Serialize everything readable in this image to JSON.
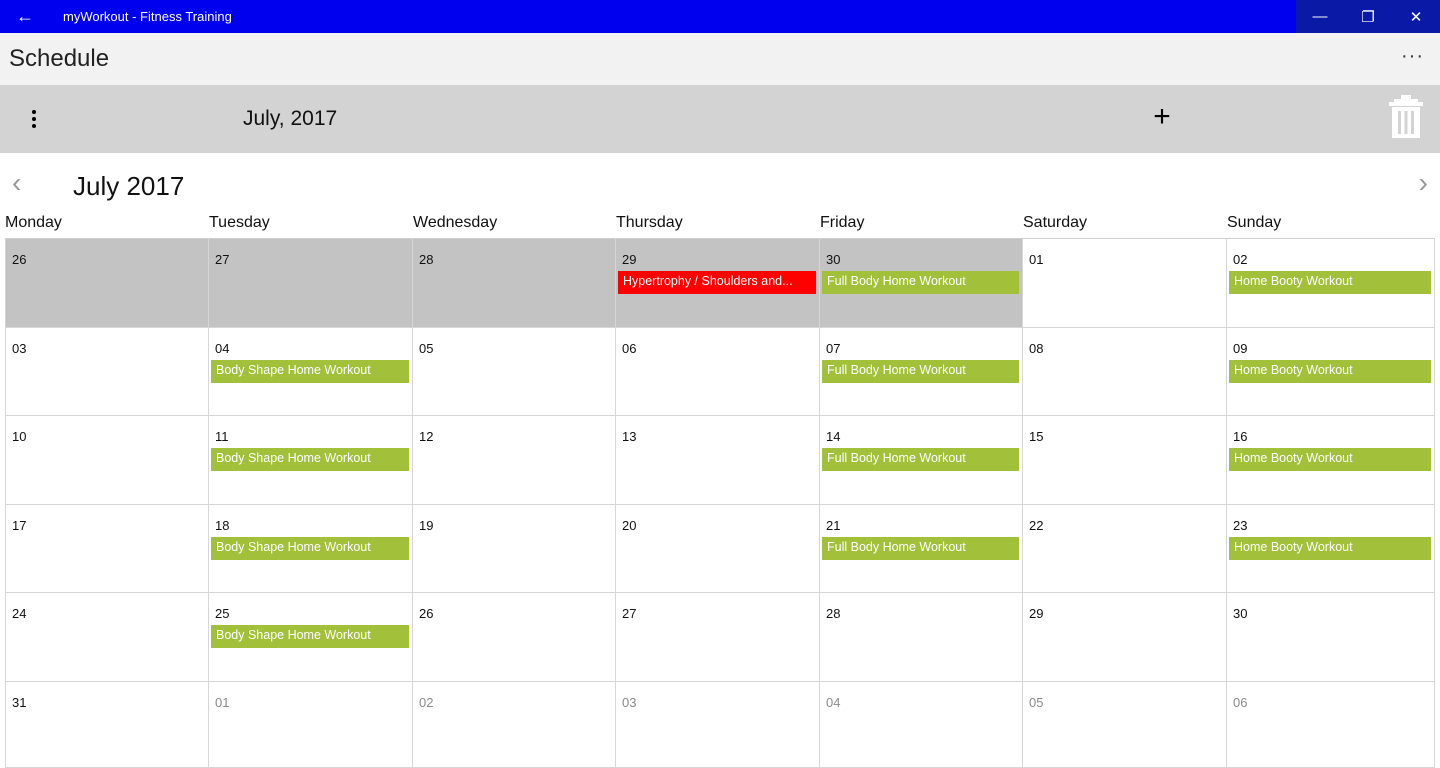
{
  "window": {
    "title": "myWorkout - Fitness Training",
    "back_icon": "←",
    "minimize_icon": "—",
    "restore_icon": "❐",
    "close_icon": "✕"
  },
  "header": {
    "title": "Schedule",
    "more_icon": "···"
  },
  "toolbar": {
    "month_label": "July, 2017",
    "add_icon": "+"
  },
  "calendar": {
    "title": "July 2017",
    "prev_icon": "‹",
    "next_icon": "›",
    "weekdays": [
      "Monday",
      "Tuesday",
      "Wednesday",
      "Thursday",
      "Friday",
      "Saturday",
      "Sunday"
    ],
    "rows": [
      [
        {
          "day": "26",
          "prev_month": true,
          "events": []
        },
        {
          "day": "27",
          "prev_month": true,
          "events": []
        },
        {
          "day": "28",
          "prev_month": true,
          "events": []
        },
        {
          "day": "29",
          "prev_month": true,
          "events": [
            {
              "title": "Hypertrophy / Shoulders and...",
              "color": "#ff0000"
            }
          ]
        },
        {
          "day": "30",
          "prev_month": true,
          "events": [
            {
              "title": "Full Body Home Workout",
              "color": "#a2c03a"
            }
          ]
        },
        {
          "day": "01",
          "events": []
        },
        {
          "day": "02",
          "events": [
            {
              "title": "Home Booty Workout",
              "color": "#a2c03a"
            }
          ]
        }
      ],
      [
        {
          "day": "03",
          "events": []
        },
        {
          "day": "04",
          "events": [
            {
              "title": "Body Shape Home Workout",
              "color": "#a2c03a"
            }
          ]
        },
        {
          "day": "05",
          "events": []
        },
        {
          "day": "06",
          "events": []
        },
        {
          "day": "07",
          "events": [
            {
              "title": "Full Body Home Workout",
              "color": "#a2c03a"
            }
          ]
        },
        {
          "day": "08",
          "events": []
        },
        {
          "day": "09",
          "events": [
            {
              "title": "Home Booty Workout",
              "color": "#a2c03a"
            }
          ]
        }
      ],
      [
        {
          "day": "10",
          "events": []
        },
        {
          "day": "11",
          "events": [
            {
              "title": "Body Shape Home Workout",
              "color": "#a2c03a"
            }
          ]
        },
        {
          "day": "12",
          "events": []
        },
        {
          "day": "13",
          "events": []
        },
        {
          "day": "14",
          "events": [
            {
              "title": "Full Body Home Workout",
              "color": "#a2c03a"
            }
          ]
        },
        {
          "day": "15",
          "events": []
        },
        {
          "day": "16",
          "events": [
            {
              "title": "Home Booty Workout",
              "color": "#a2c03a"
            }
          ]
        }
      ],
      [
        {
          "day": "17",
          "events": []
        },
        {
          "day": "18",
          "events": [
            {
              "title": "Body Shape Home Workout",
              "color": "#a2c03a"
            }
          ]
        },
        {
          "day": "19",
          "events": []
        },
        {
          "day": "20",
          "events": []
        },
        {
          "day": "21",
          "events": [
            {
              "title": "Full Body Home Workout",
              "color": "#a2c03a"
            }
          ]
        },
        {
          "day": "22",
          "events": []
        },
        {
          "day": "23",
          "events": [
            {
              "title": "Home Booty Workout",
              "color": "#a2c03a"
            }
          ]
        }
      ],
      [
        {
          "day": "24",
          "events": []
        },
        {
          "day": "25",
          "events": [
            {
              "title": "Body Shape Home Workout",
              "color": "#a2c03a"
            }
          ]
        },
        {
          "day": "26",
          "events": []
        },
        {
          "day": "27",
          "events": []
        },
        {
          "day": "28",
          "events": []
        },
        {
          "day": "29",
          "events": []
        },
        {
          "day": "30",
          "events": []
        }
      ],
      [
        {
          "day": "31",
          "events": []
        },
        {
          "day": "01",
          "next_month": true,
          "events": []
        },
        {
          "day": "02",
          "next_month": true,
          "events": []
        },
        {
          "day": "03",
          "next_month": true,
          "events": []
        },
        {
          "day": "04",
          "next_month": true,
          "events": []
        },
        {
          "day": "05",
          "next_month": true,
          "events": []
        },
        {
          "day": "06",
          "next_month": true,
          "events": []
        }
      ]
    ]
  }
}
